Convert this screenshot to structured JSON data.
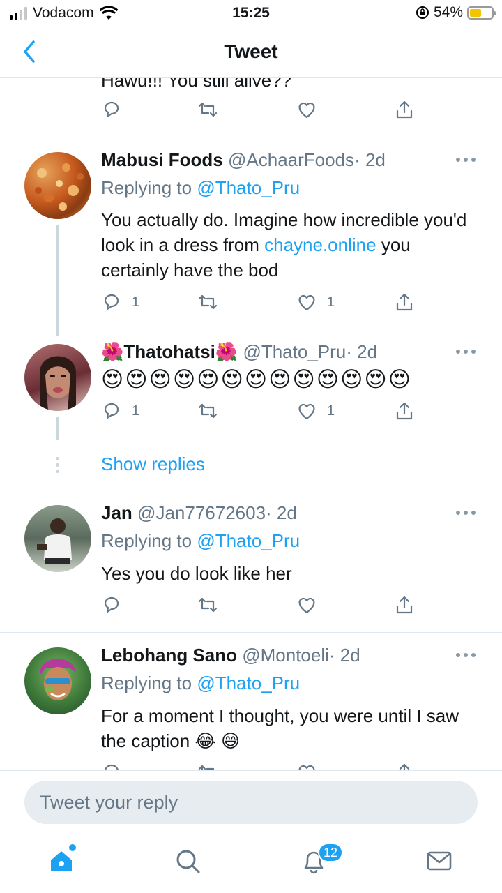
{
  "status_bar": {
    "carrier": "Vodacom",
    "time": "15:25",
    "battery": "54%"
  },
  "header": {
    "title": "Tweet"
  },
  "cut_tweet": {
    "text": "Hawu!!! You still alive??"
  },
  "tweets": [
    {
      "name": "Mabusi Foods",
      "handle": "@AchaarFoods",
      "time": "· 2d",
      "replying_label": "Replying to",
      "replying_to": "@Thato_Pru",
      "text_before": "You actually do. Imagine how incredible you'd look in a dress from",
      "link": "chayne.online",
      "text_after": "you certainly have the bod",
      "reply_count": "1",
      "like_count": "1"
    },
    {
      "name": "🌺Thatohatsi🌺",
      "handle": "@Thato_Pru",
      "time": "· 2d",
      "emojis": "😍😍😍😍😍😍😍😍😍😍😍😍😍",
      "reply_count": "1",
      "like_count": "1"
    },
    {
      "name": "Jan",
      "handle": "@Jan77672603",
      "time": "· 2d",
      "replying_label": "Replying to",
      "replying_to": "@Thato_Pru",
      "text": "Yes you do look like her"
    },
    {
      "name": "Lebohang Sano",
      "handle": "@Montoeli",
      "time": "· 2d",
      "replying_label": "Replying to",
      "replying_to": "@Thato_Pru",
      "text": "For a moment I thought, you were until I saw the caption 😂 😅"
    }
  ],
  "show_replies": "Show replies",
  "reply_bar": {
    "placeholder": "Tweet your reply"
  },
  "tabbar": {
    "notifications_badge": "12"
  },
  "colors": {
    "accent": "#1da1f2",
    "muted": "#657786",
    "divider": "#e1e8ed"
  },
  "icons": [
    "reply-icon",
    "retweet-icon",
    "like-icon",
    "share-icon",
    "more-icon",
    "home-icon",
    "search-icon",
    "notifications-icon",
    "messages-icon"
  ]
}
